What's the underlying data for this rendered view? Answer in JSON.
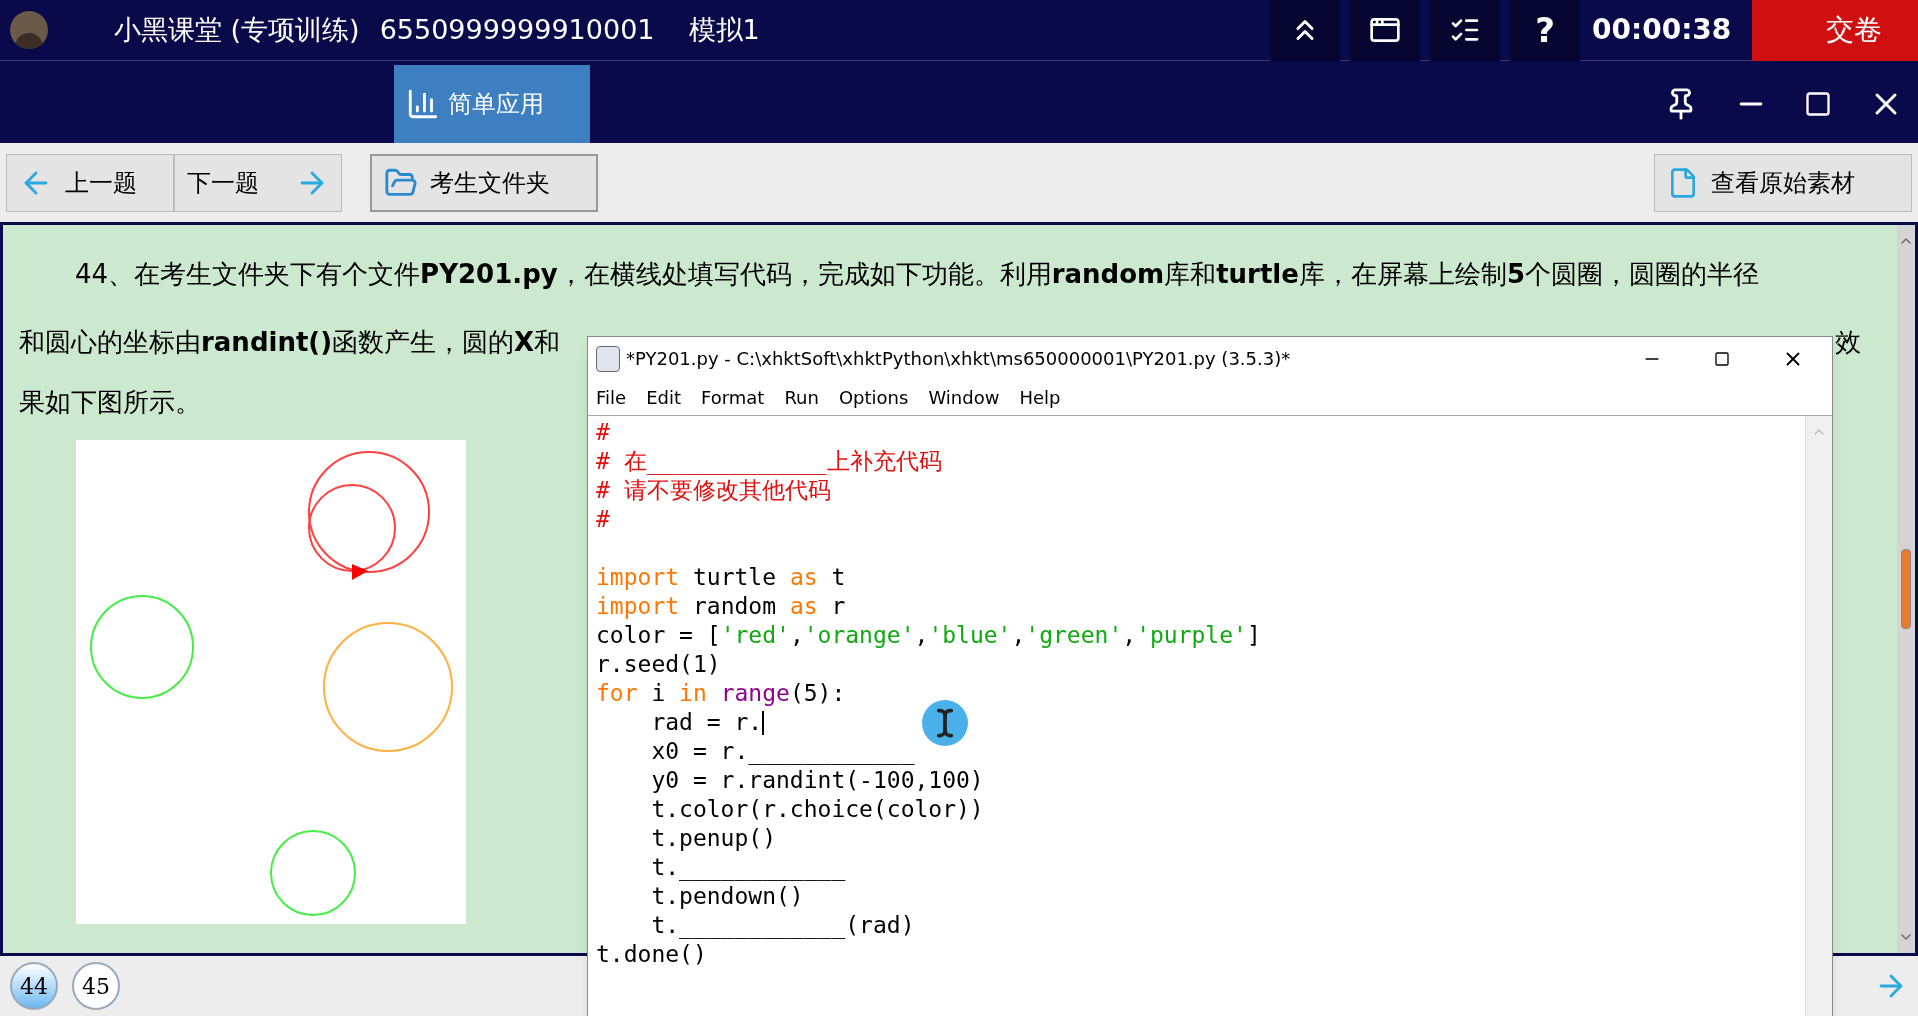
{
  "app_bar": {
    "title": "小黑课堂 (专项训练)",
    "exam_id": "6550999999910001",
    "paper": "模拟1",
    "help": "?",
    "timer": "00:00:38",
    "submit": "交卷"
  },
  "tabs": [
    {
      "label": "简单应用",
      "selected": true
    }
  ],
  "toolbar": {
    "prev": "上一题",
    "next": "下一题",
    "folder": "考生文件夹",
    "source": "查看原始素材"
  },
  "question": {
    "line_1": "44、在考生文件夹下有个文件**PY201.py**，在横线处填写代码，完成如下功能。利用**random**库和**turtle**库，在屏幕上绘制**5**个圆圈，圆圈的半径",
    "line_2": "和圆心的坐标由**randint()**函数产生，圆的**X**和",
    "line_2_end": "效",
    "line_3": "果如下图所示。"
  },
  "editor": {
    "title": "*PY201.py - C:\\xhktSoft\\xhktPython\\xhkt\\ms650000001\\PY201.py (3.5.3)*",
    "menu": [
      "File",
      "Edit",
      "Format",
      "Run",
      "Options",
      "Window",
      "Help"
    ],
    "lines": [
      {
        "kind": "code",
        "tokens": [
          {
            "t": "#",
            "kind": "comment"
          }
        ]
      },
      {
        "kind": "code",
        "tokens": [
          {
            "t": "# 在_____________上补充代码",
            "kind": "comment"
          }
        ]
      },
      {
        "kind": "code",
        "tokens": [
          {
            "t": "# 请不要修改其他代码",
            "kind": "comment"
          }
        ]
      },
      {
        "kind": "code",
        "tokens": [
          {
            "t": "#",
            "kind": "comment"
          }
        ]
      },
      {
        "kind": "blank"
      },
      {
        "kind": "code",
        "tokens": [
          {
            "t": "import",
            "kind": "keyword"
          },
          {
            "t": " turtle ",
            "kind": "plain"
          },
          {
            "t": "as",
            "kind": "keyword"
          },
          {
            "t": " t",
            "kind": "plain"
          }
        ]
      },
      {
        "kind": "code",
        "tokens": [
          {
            "t": "import",
            "kind": "keyword"
          },
          {
            "t": " random ",
            "kind": "plain"
          },
          {
            "t": "as",
            "kind": "keyword"
          },
          {
            "t": " r",
            "kind": "plain"
          }
        ]
      },
      {
        "kind": "code",
        "tokens": [
          {
            "t": "color = [",
            "kind": "plain"
          },
          {
            "t": "'red'",
            "kind": "string"
          },
          {
            "t": ",",
            "kind": "plain"
          },
          {
            "t": "'orange'",
            "kind": "string"
          },
          {
            "t": ",",
            "kind": "plain"
          },
          {
            "t": "'blue'",
            "kind": "string"
          },
          {
            "t": ",",
            "kind": "plain"
          },
          {
            "t": "'green'",
            "kind": "string"
          },
          {
            "t": ",",
            "kind": "plain"
          },
          {
            "t": "'purple'",
            "kind": "string"
          },
          {
            "t": "]",
            "kind": "plain"
          }
        ]
      },
      {
        "kind": "code",
        "tokens": [
          {
            "t": "r.seed(1)",
            "kind": "plain"
          }
        ]
      },
      {
        "kind": "code",
        "tokens": [
          {
            "t": "for",
            "kind": "keyword"
          },
          {
            "t": " i ",
            "kind": "plain"
          },
          {
            "t": "in ",
            "kind": "keyword"
          },
          {
            "t": "range",
            "kind": "builtin"
          },
          {
            "t": "(5):",
            "kind": "plain"
          }
        ]
      },
      {
        "kind": "code",
        "caret": true,
        "tokens": [
          {
            "t": "    rad = r.",
            "kind": "plain"
          }
        ]
      },
      {
        "kind": "code",
        "tokens": [
          {
            "t": "    x0 = r.____________",
            "kind": "plain"
          }
        ]
      },
      {
        "kind": "code",
        "tokens": [
          {
            "t": "    y0 = r.randint(-100,100)",
            "kind": "plain"
          }
        ]
      },
      {
        "kind": "code",
        "tokens": [
          {
            "t": "    t.color(r.choice(color))",
            "kind": "plain"
          }
        ]
      },
      {
        "kind": "code",
        "tokens": [
          {
            "t": "    t.penup()",
            "kind": "plain"
          }
        ]
      },
      {
        "kind": "code",
        "tokens": [
          {
            "t": "    t.____________",
            "kind": "plain"
          }
        ]
      },
      {
        "kind": "code",
        "tokens": [
          {
            "t": "    t.pendown()",
            "kind": "plain"
          }
        ]
      },
      {
        "kind": "code",
        "tokens": [
          {
            "t": "    t.____________(rad)",
            "kind": "plain"
          }
        ]
      },
      {
        "kind": "code",
        "tokens": [
          {
            "t": "t.done()",
            "kind": "plain"
          }
        ]
      }
    ]
  },
  "pages": [
    {
      "label": "44",
      "selected": true
    },
    {
      "label": "45",
      "selected": false
    }
  ]
}
